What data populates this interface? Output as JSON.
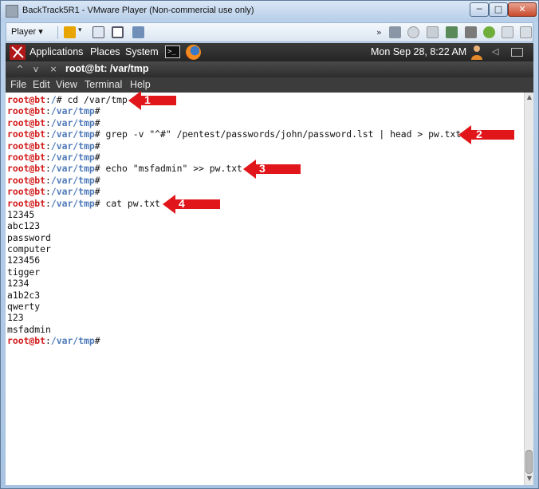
{
  "window": {
    "title": "BackTrack5R1 - VMware Player (Non-commercial use only)",
    "controls": {
      "minimize": "─",
      "maximize": "□",
      "close": "✕"
    }
  },
  "vm_toolbar": {
    "player_label": "Player ▾"
  },
  "panel": {
    "menus": [
      "Applications",
      "Places",
      "System"
    ],
    "clock": "Mon Sep 28,  8:22 AM"
  },
  "terminal": {
    "title": "root@bt: /var/tmp",
    "menu": [
      "File",
      "Edit",
      "View",
      "Terminal",
      "Help"
    ],
    "lines": [
      {
        "type": "prompt",
        "user": "root@bt",
        "path": "/",
        "cmd": " cd /var/tmp"
      },
      {
        "type": "prompt",
        "user": "root@bt",
        "path": "/var/tmp",
        "cmd": ""
      },
      {
        "type": "prompt",
        "user": "root@bt",
        "path": "/var/tmp",
        "cmd": ""
      },
      {
        "type": "prompt",
        "user": "root@bt",
        "path": "/var/tmp",
        "cmd": " grep -v \"^#\" /pentest/passwords/john/password.lst | head > pw.txt"
      },
      {
        "type": "prompt",
        "user": "root@bt",
        "path": "/var/tmp",
        "cmd": ""
      },
      {
        "type": "prompt",
        "user": "root@bt",
        "path": "/var/tmp",
        "cmd": ""
      },
      {
        "type": "prompt",
        "user": "root@bt",
        "path": "/var/tmp",
        "cmd": " echo \"msfadmin\" >> pw.txt"
      },
      {
        "type": "prompt",
        "user": "root@bt",
        "path": "/var/tmp",
        "cmd": ""
      },
      {
        "type": "prompt",
        "user": "root@bt",
        "path": "/var/tmp",
        "cmd": ""
      },
      {
        "type": "prompt",
        "user": "root@bt",
        "path": "/var/tmp",
        "cmd": " cat pw.txt"
      },
      {
        "type": "out",
        "text": "12345"
      },
      {
        "type": "out",
        "text": "abc123"
      },
      {
        "type": "out",
        "text": "password"
      },
      {
        "type": "out",
        "text": "computer"
      },
      {
        "type": "out",
        "text": "123456"
      },
      {
        "type": "out",
        "text": "tigger"
      },
      {
        "type": "out",
        "text": "1234"
      },
      {
        "type": "out",
        "text": "a1b2c3"
      },
      {
        "type": "out",
        "text": "qwerty"
      },
      {
        "type": "out",
        "text": "123"
      },
      {
        "type": "out",
        "text": "msfadmin"
      },
      {
        "type": "prompt",
        "user": "root@bt",
        "path": "/var/tmp",
        "cmd": ""
      }
    ]
  },
  "annotations": [
    {
      "number": "1"
    },
    {
      "number": "2"
    },
    {
      "number": "3"
    },
    {
      "number": "4"
    }
  ],
  "colors": {
    "prompt_user": "#d21a1a",
    "prompt_path": "#4f7ab8",
    "annotation_arrow": "#e0161b"
  }
}
